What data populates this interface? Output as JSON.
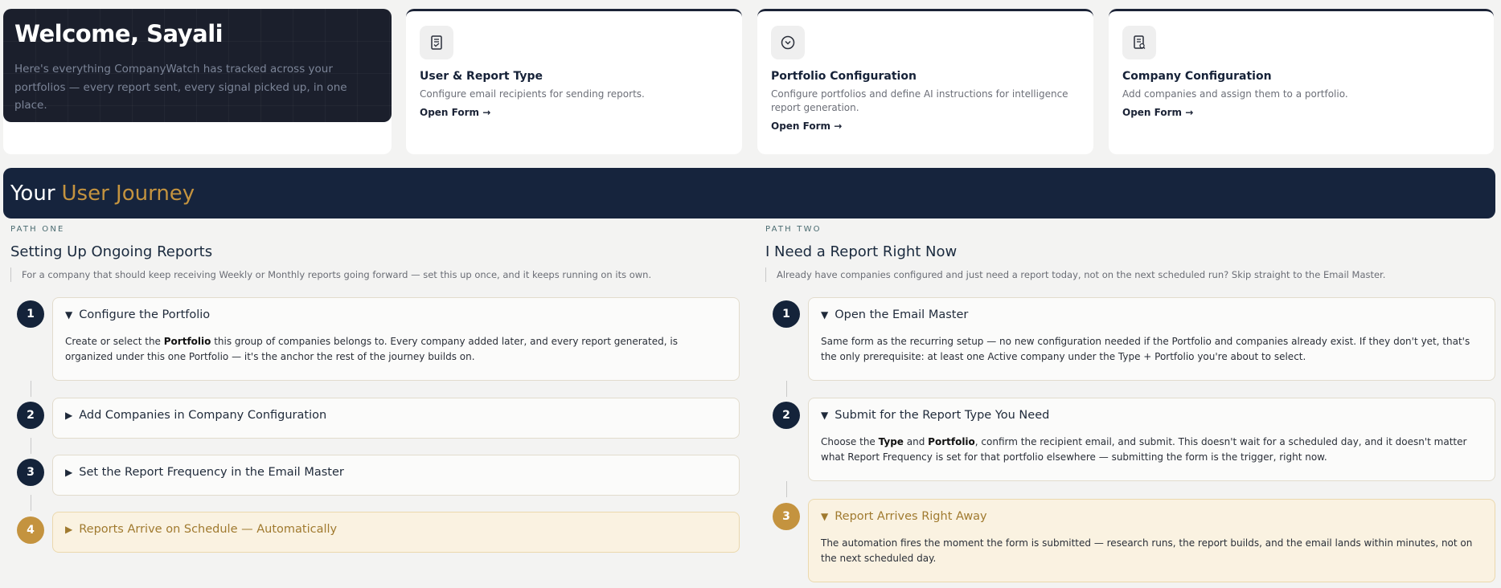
{
  "welcome": {
    "title": "Welcome, Sayali",
    "text": "Here's everything CompanyWatch has tracked across your portfolios — every report sent, every signal picked up, in one place."
  },
  "cards": [
    {
      "icon": "report-form-icon",
      "title": "User & Report Type",
      "desc": "Configure email recipients for sending reports.",
      "link": "Open Form →"
    },
    {
      "icon": "chevron-circle-icon",
      "title": "Portfolio Configuration",
      "desc": "Configure portfolios and define AI instructions for intelligence report generation.",
      "link": "Open Form →"
    },
    {
      "icon": "company-document-icon",
      "title": "Company Configuration",
      "desc": "Add companies and assign them to a portfolio.",
      "link": "Open Form →"
    }
  ],
  "journey": {
    "title_a": "Your",
    "title_b": "User Journey"
  },
  "path_one": {
    "eyebrow": "PATH ONE",
    "title": "Setting Up Ongoing Reports",
    "desc": "For a company that should keep receiving Weekly or Monthly reports going forward — set this up once, and it keeps running on its own.",
    "steps": [
      {
        "num": "1",
        "title": "Configure the Portfolio",
        "expanded": true,
        "body_parts": [
          "Create or select the ",
          "Portfolio",
          " this group of companies belongs to. Every company added later, and every report generated, is organized under this one Portfolio — it's the anchor the rest of the journey builds on."
        ]
      },
      {
        "num": "2",
        "title": "Add Companies in Company Configuration",
        "expanded": false
      },
      {
        "num": "3",
        "title": "Set the Report Frequency in the Email Master",
        "expanded": false
      },
      {
        "num": "4",
        "title": "Reports Arrive on Schedule — Automatically",
        "expanded": false
      }
    ]
  },
  "path_two": {
    "eyebrow": "PATH TWO",
    "title": "I Need a Report Right Now",
    "desc": "Already have companies configured and just need a report today, not on the next scheduled run? Skip straight to the Email Master.",
    "steps": [
      {
        "num": "1",
        "title": "Open the Email Master",
        "expanded": true,
        "body": "Same form as the recurring setup — no new configuration needed if the Portfolio and companies already exist. If they don't yet, that's the only prerequisite: at least one Active company under the Type + Portfolio you're about to select."
      },
      {
        "num": "2",
        "title": "Submit for the Report Type You Need",
        "expanded": true,
        "body_parts": [
          "Choose the ",
          "Type",
          " and ",
          "Portfolio",
          ", confirm the recipient email, and submit. This doesn't wait for a scheduled day, and it doesn't matter what Report Frequency is set for that portfolio elsewhere — submitting the form is the trigger, right now."
        ]
      },
      {
        "num": "3",
        "title": "Report Arrives Right Away",
        "expanded": true,
        "body": "The automation fires the moment the form is submitted — research runs, the report builds, and the email lands within minutes, not on the next scheduled day."
      }
    ]
  },
  "glyphs": {
    "expanded": "▼",
    "collapsed": "▶"
  },
  "colors": {
    "navy": "#16243d",
    "gold": "#c4933f",
    "gold_bg": "#faf2e1"
  }
}
